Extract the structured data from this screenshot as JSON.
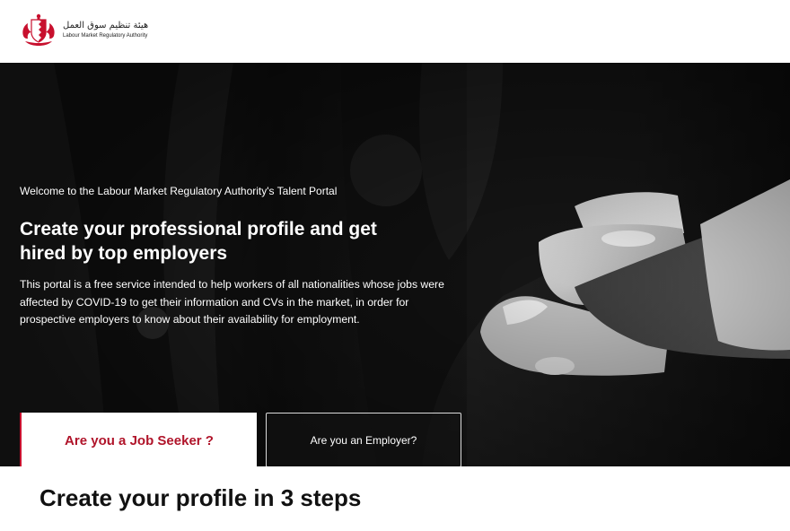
{
  "header": {
    "logo_arabic": "هيئة تنظيم سوق العمل",
    "logo_english": "Labour Market Regulatory Authority",
    "logo_icon": "bahrain-emblem-icon"
  },
  "hero": {
    "welcome": "Welcome to the Labour Market Regulatory Authority's Talent Portal",
    "headline": "Create your professional profile and get hired by top employers",
    "description": "This portal is a free service intended to help workers of all nationalities whose jobs were affected by COVID-19 to get their information and CVs in the market, in order for prospective employers to know about their availability for employment.",
    "image": "handshake-photo"
  },
  "tabs": {
    "job_seeker": "Are you a Job Seeker ?",
    "employer": "Are you an Employer?"
  },
  "main": {
    "steps_title": "Create your profile in 3 steps"
  },
  "colors": {
    "accent": "#b0142a",
    "emblem_red": "#c8102e"
  }
}
